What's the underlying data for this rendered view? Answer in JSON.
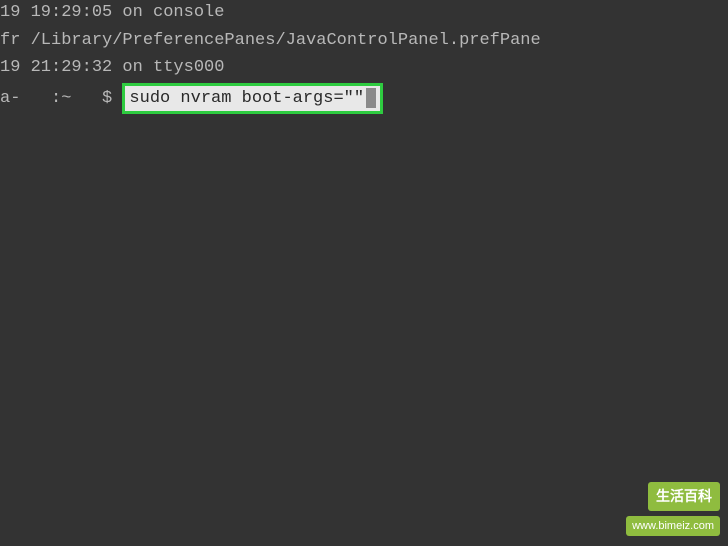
{
  "terminal": {
    "line1": "19 19:29:05 on console",
    "line2": "fr /Library/PreferencePanes/JavaControlPanel.prefPane",
    "line3": "",
    "line4": "19 21:29:32 on ttys000",
    "prompt_prefix": "a-   :~   $ ",
    "command": "sudo nvram boot-args=\"\""
  },
  "watermark": {
    "badge": "生活百科",
    "url": "www.bimeiz.com"
  }
}
